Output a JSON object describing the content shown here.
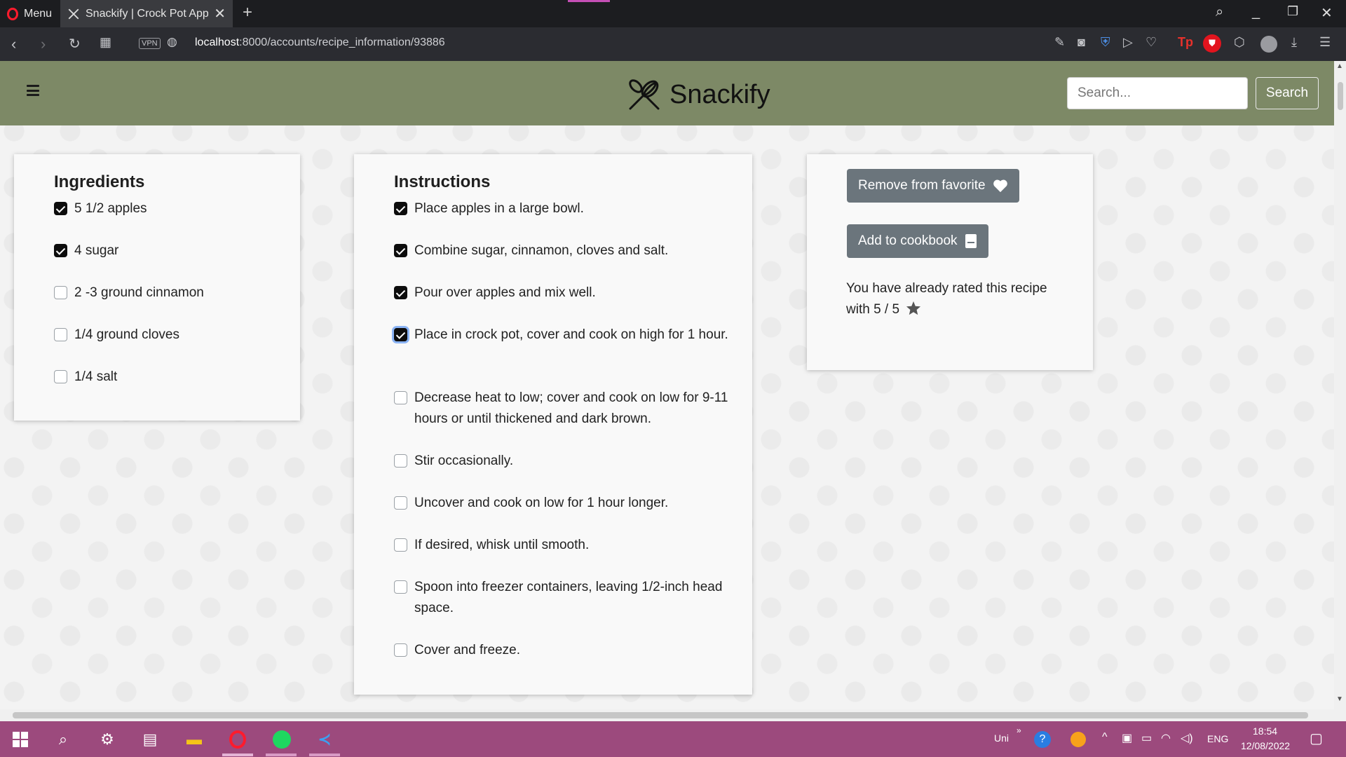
{
  "browser": {
    "menu_label": "Menu",
    "tab_title": "Snackify | Crock Pot Apple I",
    "url_host": "localhost",
    "url_rest": ":8000/accounts/recipe_information/93886",
    "vpn_label": "VPN"
  },
  "site": {
    "brand": "Snackify",
    "search_placeholder": "Search...",
    "search_button": "Search"
  },
  "ingredients": {
    "heading": "Ingredients",
    "items": [
      {
        "label": "5 1/2 apples",
        "checked": true
      },
      {
        "label": "4 sugar",
        "checked": true
      },
      {
        "label": "2 -3 ground cinnamon",
        "checked": false
      },
      {
        "label": "1/4 ground cloves",
        "checked": false
      },
      {
        "label": "1/4 salt",
        "checked": false
      }
    ]
  },
  "instructions": {
    "heading": "Instructions",
    "steps": [
      {
        "label": "Place apples in a large bowl.",
        "checked": true
      },
      {
        "label": "Combine sugar, cinnamon, cloves and salt.",
        "checked": true
      },
      {
        "label": "Pour over apples and mix well.",
        "checked": true
      },
      {
        "label": "Place in crock pot, cover and cook on high for 1 hour.",
        "checked": true
      },
      {
        "label": "Decrease heat to low; cover and cook on low for 9-11 hours or until thickened and dark brown.",
        "checked": false
      },
      {
        "label": "Stir occasionally.",
        "checked": false
      },
      {
        "label": "Uncover and cook on low for 1 hour longer.",
        "checked": false
      },
      {
        "label": "If desired, whisk until smooth.",
        "checked": false
      },
      {
        "label": "Spoon into freezer containers, leaving 1/2-inch head space.",
        "checked": false
      },
      {
        "label": "Cover and freeze.",
        "checked": false
      }
    ]
  },
  "actions": {
    "remove_favorite": "Remove from favorite",
    "add_cookbook": "Add to cookbook",
    "rating_line1": "You have already rated this recipe",
    "rating_line2": "with 5 / 5",
    "rating_value": 5,
    "rating_max": 5
  },
  "taskbar": {
    "lang_short": "Uni",
    "lang": "ENG",
    "time": "18:54",
    "date": "12/08/2022"
  }
}
